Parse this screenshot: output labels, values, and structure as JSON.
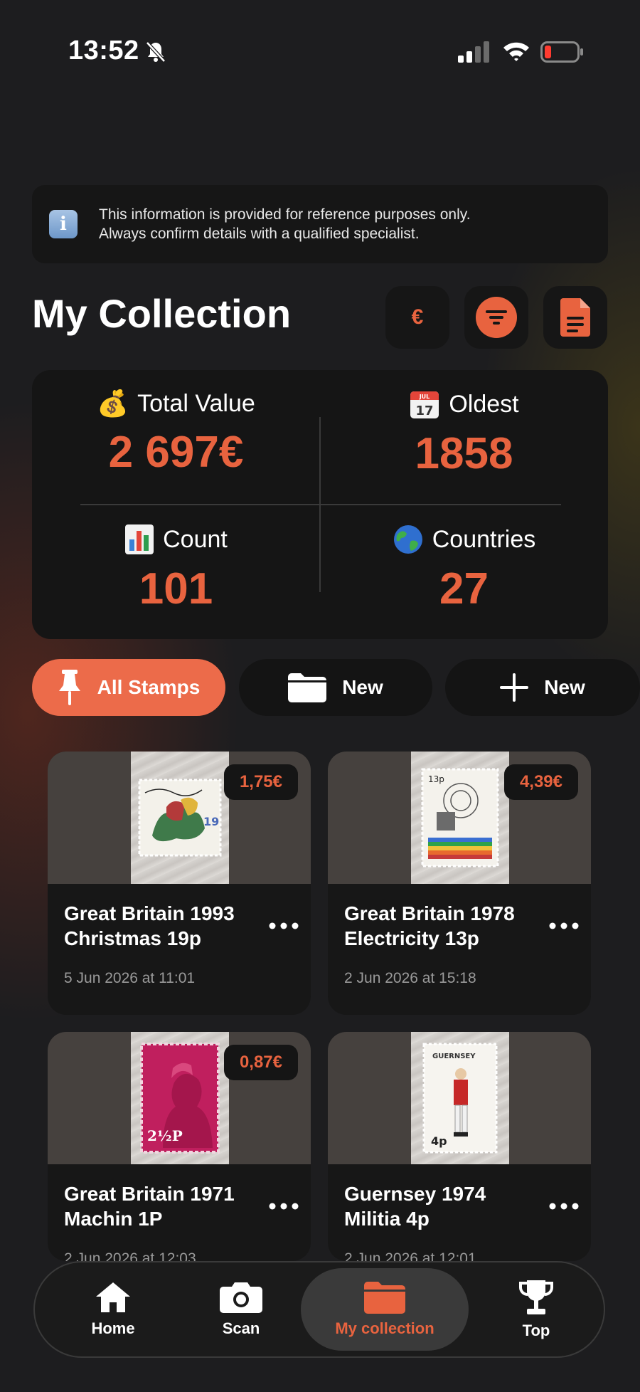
{
  "status_bar": {
    "time": "13:52"
  },
  "disclaimer": {
    "line1": "This information is provided for reference purposes only.",
    "line2": "Always confirm details with a qualified specialist."
  },
  "header": {
    "title": "My Collection",
    "currency_symbol": "€"
  },
  "stats": {
    "total_value": {
      "icon": "money-bag-icon",
      "label": "Total Value",
      "value": "2 697€"
    },
    "oldest": {
      "icon": "calendar-icon",
      "label": "Oldest",
      "value": "1858"
    },
    "count": {
      "icon": "bar-chart-icon",
      "label": "Count",
      "value": "101"
    },
    "countries": {
      "icon": "globe-icon",
      "label": "Countries",
      "value": "27"
    }
  },
  "chips": {
    "all": {
      "label": "All Stamps",
      "icon": "pin-icon"
    },
    "folder": {
      "label": "New",
      "icon": "folder-icon"
    },
    "add": {
      "label": "New",
      "icon": "plus-icon"
    }
  },
  "stamps": [
    {
      "title_line1": "Great Britain 1993",
      "title_line2": "Christmas 19p",
      "price": "1,75€",
      "date": "5 Jun 2026 at 11:01"
    },
    {
      "title_line1": "Great Britain 1978",
      "title_line2": "Electricity 13p",
      "price": "4,39€",
      "date": "2 Jun 2026 at 15:18"
    },
    {
      "title_line1": "Great Britain 1971",
      "title_line2": "Machin 1P",
      "price": "0,87€",
      "date": "2 Jun 2026 at 12:03"
    },
    {
      "title_line1": "Guernsey 1974",
      "title_line2": "Militia 4p",
      "price": "",
      "date": "2 Jun 2026 at 12:01"
    }
  ],
  "nav": {
    "home": "Home",
    "scan": "Scan",
    "collection": "My collection",
    "top": "Top"
  },
  "colors": {
    "accent": "#e8633f",
    "background": "#1d1d1f",
    "card": "#151515"
  }
}
